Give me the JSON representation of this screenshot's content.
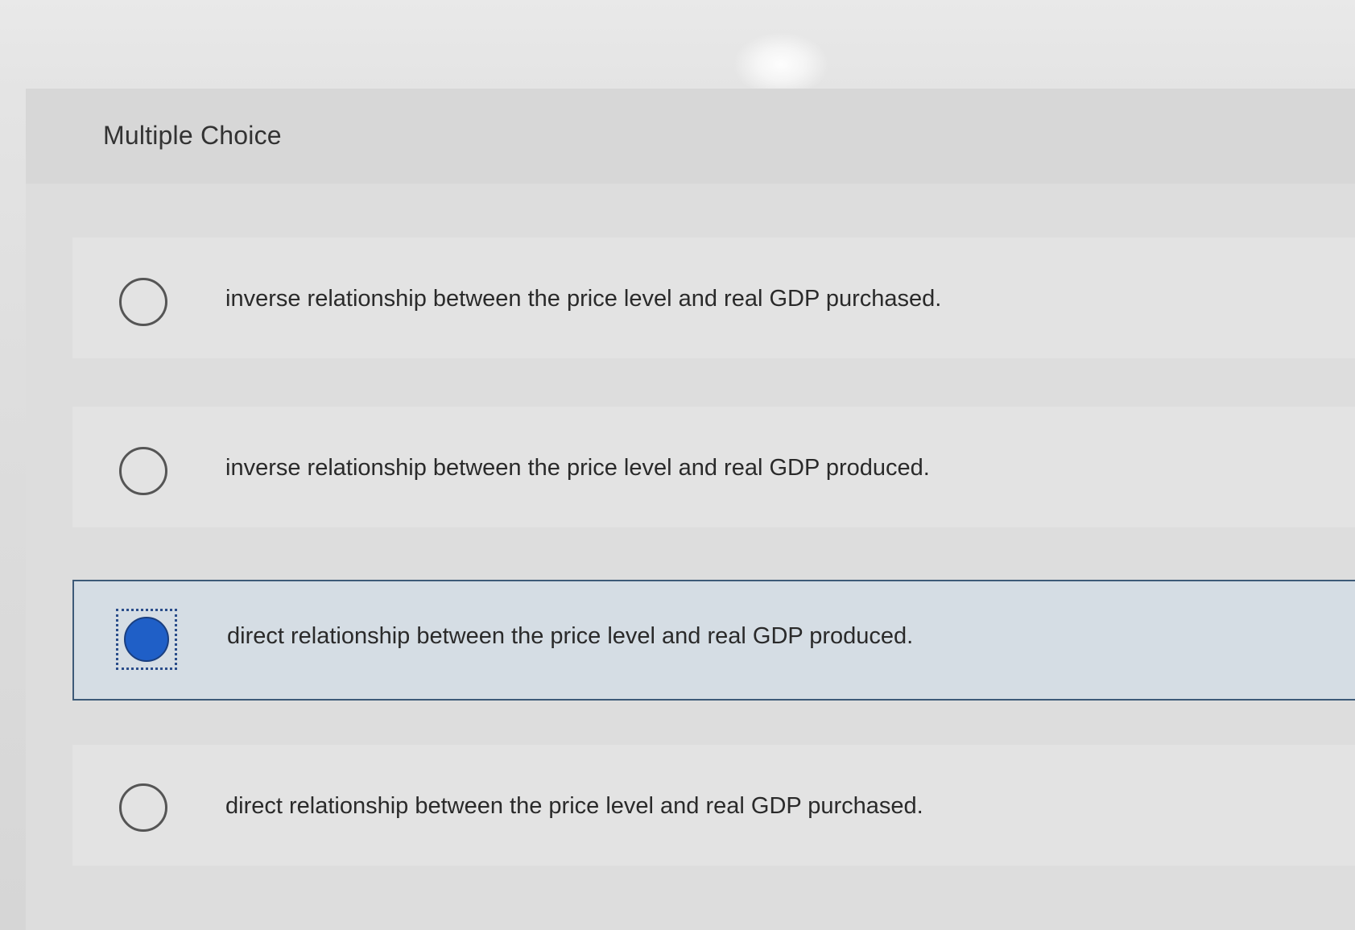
{
  "question": {
    "type_label": "Multiple Choice"
  },
  "choices": [
    {
      "label": "inverse relationship between the price level and real GDP purchased.",
      "selected": false
    },
    {
      "label": "inverse relationship between the price level and real GDP produced.",
      "selected": false
    },
    {
      "label": "direct relationship between the price level and real GDP produced.",
      "selected": true
    },
    {
      "label": "direct relationship between the price level and real GDP purchased.",
      "selected": false
    }
  ],
  "colors": {
    "selected_fill": "#1f5fc7",
    "selected_border": "#3d5a78",
    "selected_background": "#d5dde4"
  }
}
